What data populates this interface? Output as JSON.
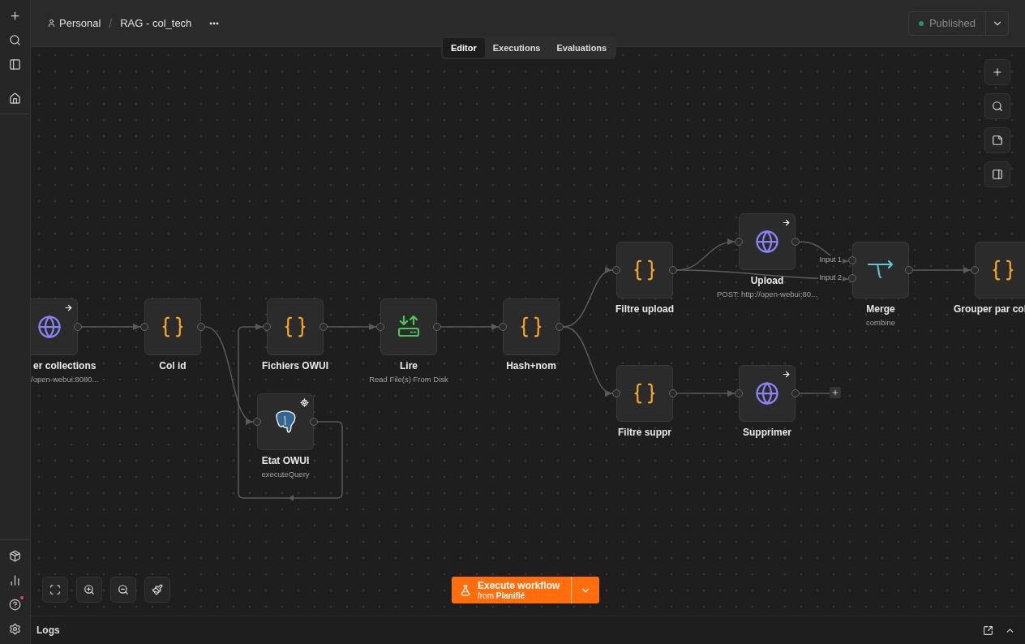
{
  "breadcrumb": [
    {
      "label": "Personal"
    },
    {
      "label": "RAG - col_tech"
    }
  ],
  "breadcrumb_separator": "/",
  "tabs": [
    {
      "label": "Editor",
      "selected": true
    },
    {
      "label": "Executions",
      "selected": false
    },
    {
      "label": "Evaluations",
      "selected": false
    }
  ],
  "publish": {
    "label": "Published"
  },
  "nodes": [
    {
      "kind": "http",
      "name": "er collections",
      "subtitle": "/open-webui:8080..."
    },
    {
      "kind": "code",
      "name": "Col id"
    },
    {
      "kind": "code",
      "name": "Fichiers OWUI"
    },
    {
      "kind": "file",
      "name": "Lire",
      "subtitle": "Read File(s) From Disk"
    },
    {
      "kind": "code",
      "name": "Hash+nom"
    },
    {
      "kind": "postgres",
      "name": "Etat OWUI",
      "subtitle": "executeQuery"
    },
    {
      "kind": "code",
      "name": "Filtre upload"
    },
    {
      "kind": "http",
      "name": "Upload",
      "subtitle": "POST: http://open-webui:80..."
    },
    {
      "kind": "merge",
      "name": "Merge",
      "subtitle": "combine",
      "inputs": [
        "Input 1",
        "Input 2"
      ]
    },
    {
      "kind": "code",
      "name": "Grouper par col"
    },
    {
      "kind": "code",
      "name": "Filtre suppr"
    },
    {
      "kind": "http",
      "name": "Supprimer"
    }
  ],
  "execute": {
    "label": "Execute workflow",
    "source": "from **Planifié**"
  },
  "help_notification": true,
  "logs": {
    "label": "Logs"
  }
}
